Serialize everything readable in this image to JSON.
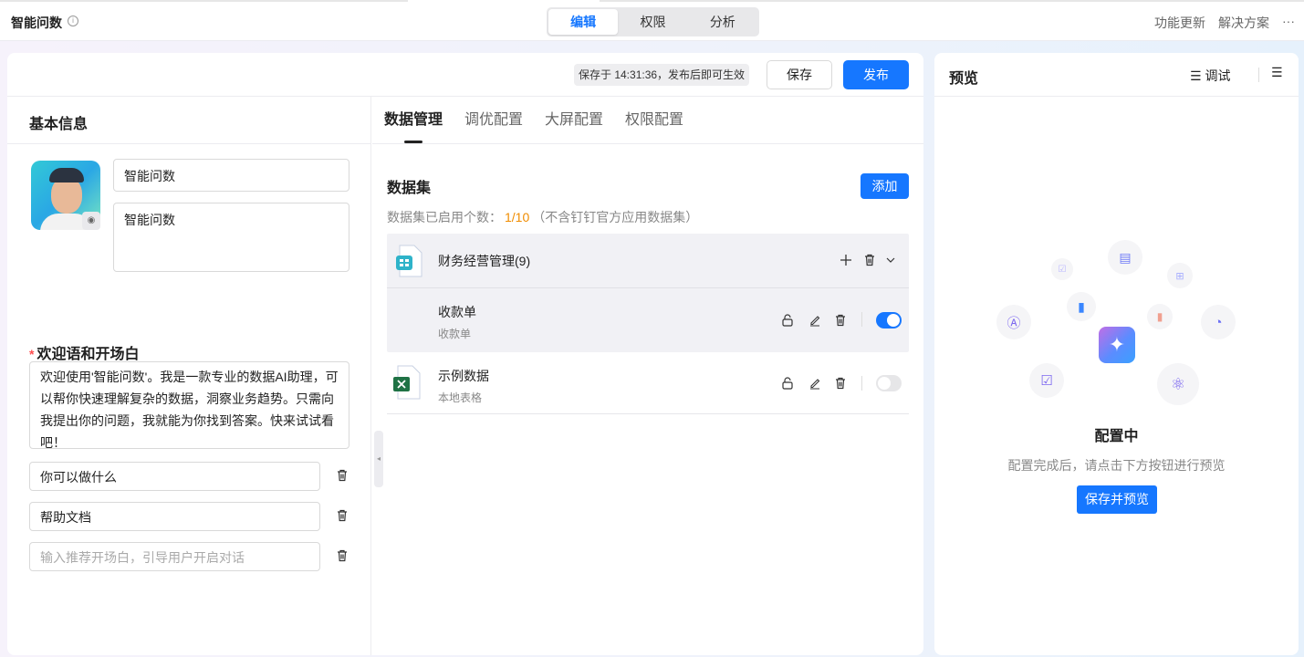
{
  "header": {
    "title": "智能问数",
    "mode_tabs": [
      {
        "label": "编辑",
        "active": true
      },
      {
        "label": "权限",
        "active": false
      },
      {
        "label": "分析",
        "active": false
      }
    ],
    "links": [
      "功能更新",
      "解决方案"
    ],
    "more": "···"
  },
  "toolbar": {
    "save_status": "保存于 14:31:36，发布后即可生效",
    "save_label": "保存",
    "publish_label": "发布"
  },
  "basic": {
    "title": "基本信息",
    "name_value": "智能问数",
    "desc_value": "智能问数",
    "welcome_title": "欢迎语和开场白",
    "welcome_text": "欢迎使用'智能问数'。我是一款专业的数据AI助理，可以帮你快速理解复杂的数据，洞察业务趋势。只需向我提出你的问题，我就能为你找到答案。快来试试看吧！",
    "prompts": [
      "你可以做什么",
      "帮助文档"
    ],
    "prompt_placeholder": "输入推荐开场白，引导用户开启对话"
  },
  "config": {
    "tabs": [
      {
        "label": "数据管理",
        "active": true
      },
      {
        "label": "调优配置"
      },
      {
        "label": "大屏配置"
      },
      {
        "label": "权限配置"
      }
    ],
    "dataset_title": "数据集",
    "add_label": "添加",
    "count_prefix": "数据集已启用个数：",
    "count_value": "1/10",
    "count_suffix": "（不含钉钉官方应用数据集）",
    "group": {
      "name": "财务经营管理(9)",
      "items": [
        {
          "name": "收款单",
          "sub": "收款单",
          "enabled": true
        }
      ]
    },
    "items": [
      {
        "name": "示例数据",
        "sub": "本地表格",
        "enabled": false
      }
    ]
  },
  "preview": {
    "title": "预览",
    "debug_label": "调试",
    "state_title": "配置中",
    "state_desc": "配置完成后，请点击下方按钮进行预览",
    "button_label": "保存并预览"
  },
  "colors": {
    "accent": "#1677ff",
    "count": "#f08c00"
  }
}
